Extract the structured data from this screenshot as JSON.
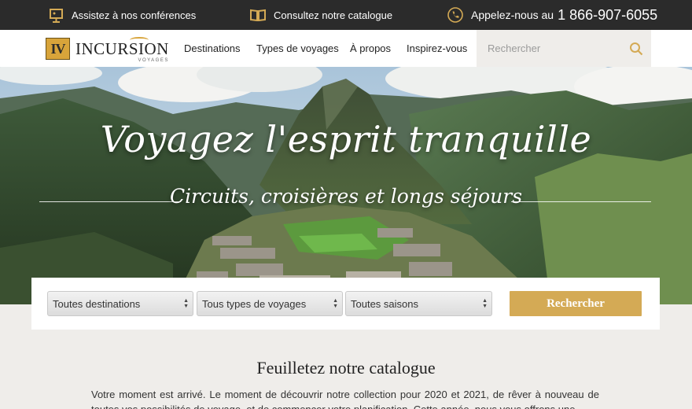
{
  "topbar": {
    "conferences": "Assistez à nos conférences",
    "catalogue": "Consultez notre catalogue",
    "phone_prefix": "Appelez-nous au",
    "phone_number": "1 866-907-6055"
  },
  "logo": {
    "main": "INCURSION",
    "sub": "VOYAGES",
    "mark": "IV"
  },
  "nav": {
    "items": [
      "Destinations",
      "Types de voyages",
      "À propos",
      "Inspirez-vous"
    ],
    "search_placeholder": "Rechercher"
  },
  "hero": {
    "title": "Voyagez l'esprit tranquille",
    "subtitle": "Circuits, croisières et longs séjours"
  },
  "search_form": {
    "destination": "Toutes destinations",
    "type": "Tous types de voyages",
    "season": "Toutes saisons",
    "submit": "Rechercher"
  },
  "catalogue": {
    "title": "Feuilletez notre catalogue",
    "text": "Votre moment est arrivé. Le moment de découvrir notre collection pour 2020 et 2021, de rêver à nouveau de toutes vos possibilités de voyage, et de commencer votre planification. Cette année, nous vous offrons une"
  },
  "colors": {
    "accent": "#d4aa55",
    "topbar": "#2b2b2b",
    "page_bg": "#efedea"
  }
}
